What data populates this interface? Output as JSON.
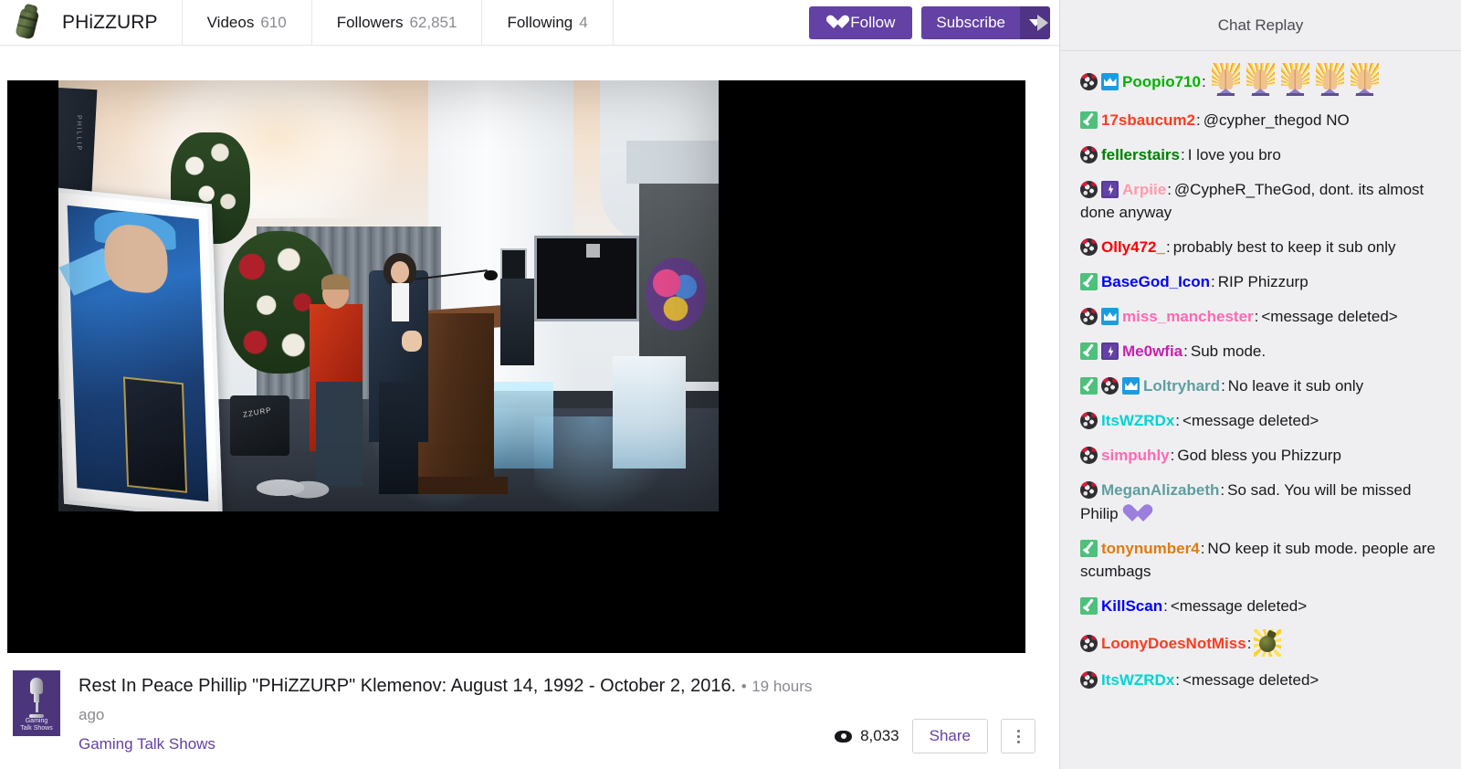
{
  "header": {
    "logo_icon": "grenade-icon",
    "channel_name": "PHiZZURP",
    "tabs": [
      {
        "label": "Videos",
        "count": "610"
      },
      {
        "label": "Followers",
        "count": "62,851"
      },
      {
        "label": "Following",
        "count": "4"
      }
    ],
    "follow_label": "Follow",
    "follow_icon": "heart-icon",
    "subscribe_label": "Subscribe",
    "subscribe_caret_icon": "chevron-down-icon",
    "collapse_icon": "chevron-right-icon",
    "accent_color": "#6441a4",
    "accent_dark_color": "#4f3384"
  },
  "video": {
    "title": "Rest In Peace Phillip \"PHiZZURP\" Klemenov: August 14, 1992 - October 2, 2016.",
    "separator": "•",
    "time_ago": "19 hours ago",
    "game": "Gaming Talk Shows",
    "thumb_label_line1": "Gaming",
    "thumb_label_line2": "Talk Shows",
    "views": "8,033",
    "views_icon": "eye-icon",
    "share_label": "Share",
    "more_icon": "kebab-menu-icon",
    "banner_text": "PHILLIP",
    "bag_text": "ZZURP"
  },
  "chat": {
    "title": "Chat Replay",
    "background_color": "#efeff1",
    "messages": [
      {
        "badges": [
          "mod",
          "prime"
        ],
        "user": "Poopio710",
        "color": "#00b300",
        "text": "",
        "emotes": [
          "pray",
          "pray",
          "pray",
          "pray",
          "pray"
        ]
      },
      {
        "badges": [
          "sub"
        ],
        "user": "17sbaucum2",
        "color": "#ff3b1f",
        "text": "@cypher_thegod NO",
        "emotes": []
      },
      {
        "badges": [
          "mod"
        ],
        "user": "fellerstairs",
        "color": "#008000",
        "text": "I love you bro",
        "emotes": []
      },
      {
        "badges": [
          "mod",
          "turbo"
        ],
        "user": "Arpiie",
        "color": "#ff9baa",
        "text": "@CypheR_TheGod, dont. its almost done anyway",
        "emotes": []
      },
      {
        "badges": [
          "mod"
        ],
        "user": "Olly472_",
        "color": "#ff0000",
        "text": "probably best to keep it sub only",
        "emotes": []
      },
      {
        "badges": [
          "sub"
        ],
        "user": "BaseGod_Icon",
        "color": "#0000ff",
        "text": "RIP Phizzurp",
        "emotes": []
      },
      {
        "badges": [
          "mod",
          "prime"
        ],
        "user": "miss_manchester",
        "color": "#ff69b4",
        "text": "<message deleted>",
        "emotes": []
      },
      {
        "badges": [
          "sub",
          "turbo"
        ],
        "user": "Me0wfia",
        "color": "#c820b0",
        "text": "Sub mode.",
        "emotes": []
      },
      {
        "badges": [
          "sub",
          "mod",
          "prime"
        ],
        "user": "Loltryhard",
        "color": "#5f9ea0",
        "text": "No leave it sub only",
        "emotes": []
      },
      {
        "badges": [
          "mod"
        ],
        "user": "ItsWZRDx",
        "color": "#00d4d4",
        "text": "<message deleted>",
        "emotes": []
      },
      {
        "badges": [
          "mod"
        ],
        "user": "simpuhly",
        "color": "#ff69b4",
        "text": "God bless you Phizzurp",
        "emotes": []
      },
      {
        "badges": [
          "mod"
        ],
        "user": "MeganAlizabeth",
        "color": "#5f9ea0",
        "text": "So sad. You will be missed Philip",
        "emotes": [
          "heart"
        ]
      },
      {
        "badges": [
          "sub"
        ],
        "user": "tonynumber4",
        "color": "#e07b10",
        "text": "NO keep it sub mode. people are scumbags",
        "emotes": []
      },
      {
        "badges": [
          "sub"
        ],
        "user": "KillScan",
        "color": "#0000ff",
        "text": "<message deleted>",
        "emotes": []
      },
      {
        "badges": [
          "mod"
        ],
        "user": "LoonyDoesNotMiss",
        "color": "#ff3b1f",
        "text": "",
        "emotes": [
          "grenade"
        ]
      },
      {
        "badges": [
          "mod"
        ],
        "user": "ItsWZRDx",
        "color": "#00d4d4",
        "text": "<message deleted>",
        "emotes": []
      }
    ]
  }
}
